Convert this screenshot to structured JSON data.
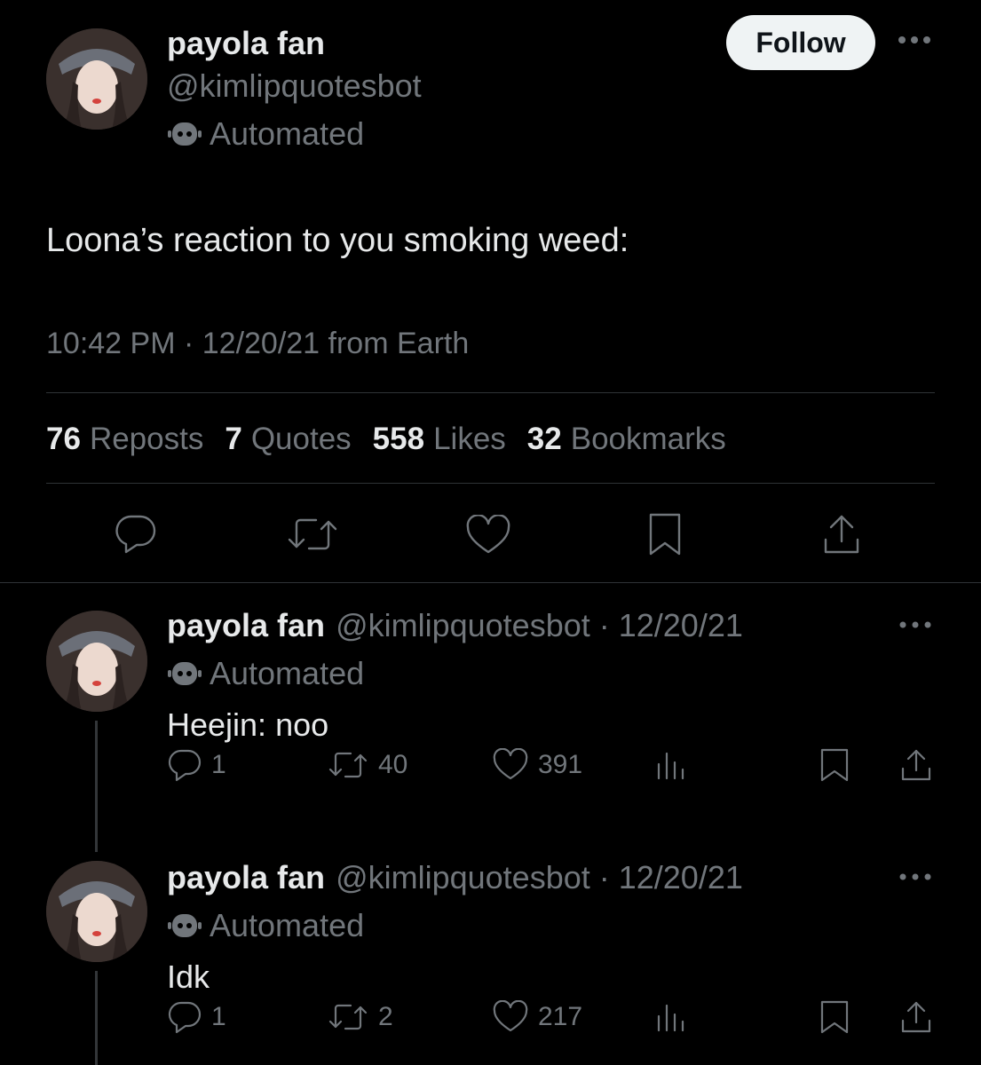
{
  "main_tweet": {
    "author_name": "payola fan",
    "handle": "@kimlipquotesbot",
    "automated_label": "Automated",
    "follow_label": "Follow",
    "text": "Loona’s reaction to you smoking weed:",
    "timestamp": "10:42 PM · 12/20/21 from Earth",
    "stats": {
      "reposts_count": "76",
      "reposts_label": "Reposts",
      "quotes_count": "7",
      "quotes_label": "Quotes",
      "likes_count": "558",
      "likes_label": "Likes",
      "bookmarks_count": "32",
      "bookmarks_label": "Bookmarks"
    }
  },
  "replies": [
    {
      "author_name": "payola fan",
      "handle_date": "@kimlipquotesbot · 12/20/21",
      "automated_label": "Automated",
      "text": "Heejin: noo",
      "reply_count": "1",
      "repost_count": "40",
      "like_count": "391"
    },
    {
      "author_name": "payola fan",
      "handle_date": "@kimlipquotesbot · 12/20/21",
      "automated_label": "Automated",
      "text": "Idk",
      "reply_count": "1",
      "repost_count": "2",
      "like_count": "217"
    }
  ],
  "colors": {
    "background": "#000000",
    "text": "#e7e9ea",
    "muted": "#71767b",
    "divider": "#2f3336"
  },
  "icons": [
    "more-icon",
    "bot-icon",
    "reply-icon",
    "repost-icon",
    "like-icon",
    "bookmark-icon",
    "share-icon",
    "views-icon"
  ]
}
